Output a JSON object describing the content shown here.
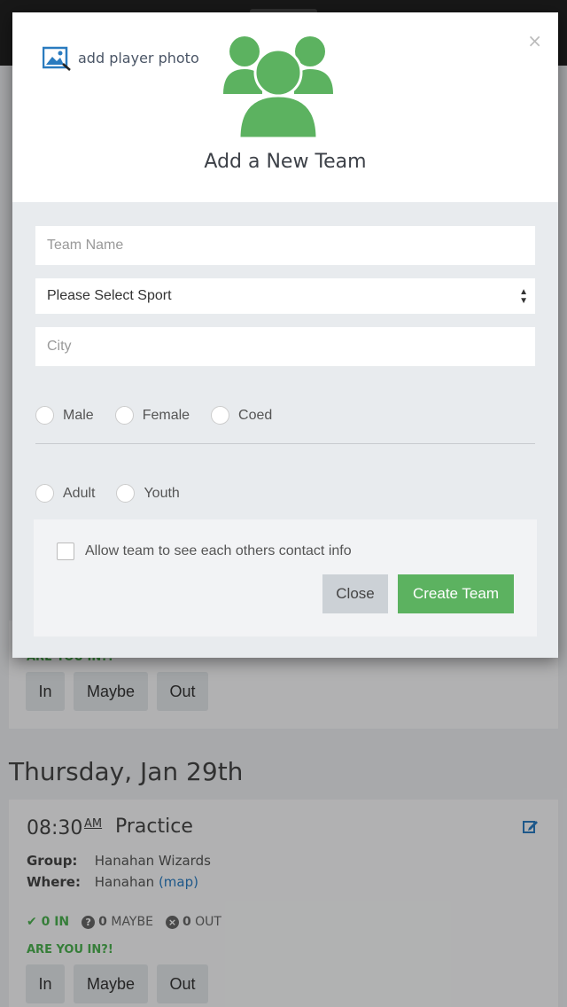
{
  "modal": {
    "close_glyph": "×",
    "add_photo_label": "add player photo",
    "title": "Add a New Team",
    "team_name_placeholder": "Team Name",
    "sport_select_value": "Please Select Sport",
    "city_placeholder": "City",
    "gender_options": [
      "Male",
      "Female",
      "Coed"
    ],
    "age_options": [
      "Adult",
      "Youth"
    ],
    "contact_checkbox_label": "Allow team to see each others contact info",
    "contact_checkbox_checked": false,
    "close_button": "Close",
    "create_button": "Create Team",
    "accent_color": "#5cb260"
  },
  "background": {
    "prev_event": {
      "rsvp_prompt": "ARE YOU IN?!",
      "buttons": [
        "In",
        "Maybe",
        "Out"
      ]
    },
    "day_heading": "Thursday, Jan 29th",
    "event": {
      "time": "08:30",
      "ampm": "AM",
      "title": "Practice",
      "group_label": "Group:",
      "group_value": "Hanahan Wizards",
      "where_label": "Where:",
      "where_value": "Hanahan",
      "map_link": "(map)",
      "in_count": "0 IN",
      "maybe_count": "0",
      "maybe_label": "MAYBE",
      "out_count": "0",
      "out_label": "OUT",
      "rsvp_prompt": "ARE YOU IN?!",
      "buttons": [
        "In",
        "Maybe",
        "Out"
      ]
    }
  }
}
